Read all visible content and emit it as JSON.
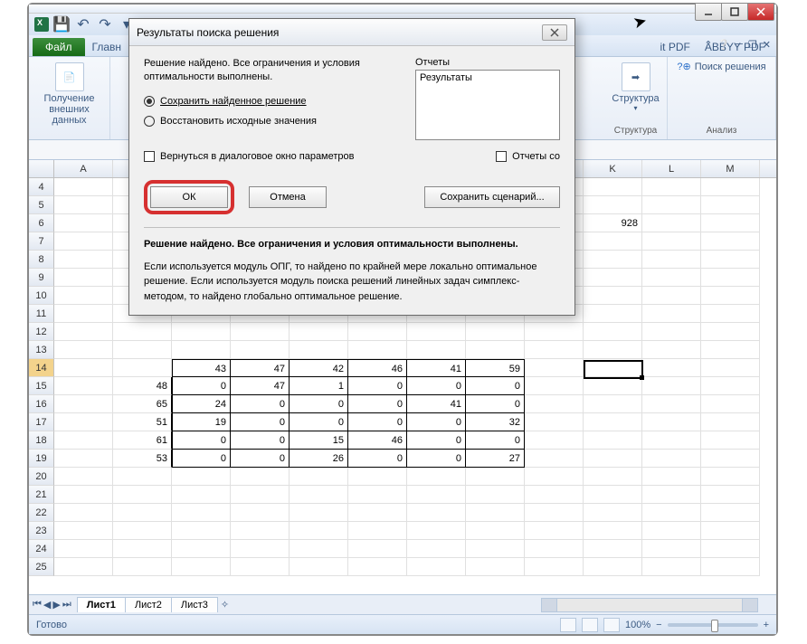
{
  "window": {
    "qat": {
      "save": "💾",
      "undo": "↶",
      "redo": "↷"
    }
  },
  "ribbon": {
    "file": "Файл",
    "tabs": [
      "Главн"
    ],
    "right_tabs": [
      "it PDF",
      "ABBYY PDF"
    ],
    "group_getdata": {
      "label": "Получение\nвнешних данных",
      "sublabel": ""
    },
    "group_structure": {
      "label": "Структура",
      "btn": "Структура"
    },
    "group_analysis": {
      "label": "Анализ",
      "solver": "Поиск решения"
    }
  },
  "columns": [
    "A",
    "",
    "",
    "",
    "",
    "",
    "",
    "",
    "",
    "K",
    "L",
    "M"
  ],
  "rows_start": 4,
  "rows_end": 25,
  "grid": {
    "k6": "928",
    "r14": [
      "",
      "",
      "43",
      "47",
      "42",
      "46",
      "41",
      "59",
      "",
      ""
    ],
    "r15": [
      "",
      "48",
      "0",
      "47",
      "1",
      "0",
      "0",
      "0",
      "",
      ""
    ],
    "r16": [
      "",
      "65",
      "24",
      "0",
      "0",
      "0",
      "41",
      "0",
      "",
      ""
    ],
    "r17": [
      "",
      "51",
      "19",
      "0",
      "0",
      "0",
      "0",
      "32",
      "",
      ""
    ],
    "r18": [
      "",
      "61",
      "0",
      "0",
      "15",
      "46",
      "0",
      "0",
      "",
      ""
    ],
    "r19": [
      "",
      "53",
      "0",
      "0",
      "26",
      "0",
      "0",
      "27",
      "",
      ""
    ]
  },
  "sheets": {
    "active": "Лист1",
    "others": [
      "Лист2",
      "Лист3"
    ]
  },
  "status": {
    "ready": "Готово",
    "zoom": "100%"
  },
  "dialog": {
    "title": "Результаты поиска решения",
    "msg": "Решение найдено. Все ограничения и условия оптимальности выполнены.",
    "radio1": "Сохранить найденное решение",
    "radio2": "Восстановить исходные значения",
    "reports_label": "Отчеты",
    "reports_item": "Результаты",
    "chk1": "Вернуться в диалоговое окно параметров",
    "chk2": "Отчеты со",
    "ok": "ОК",
    "cancel": "Отмена",
    "save_scenario": "Сохранить сценарий...",
    "info_bold": "Решение найдено. Все ограничения и условия оптимальности выполнены.",
    "info_text": "Если используется модуль ОПГ, то найдено по крайней мере локально оптимальное решение. Если используется модуль поиска решений линейных задач симплекс-методом, то найдено глобально оптимальное решение."
  }
}
